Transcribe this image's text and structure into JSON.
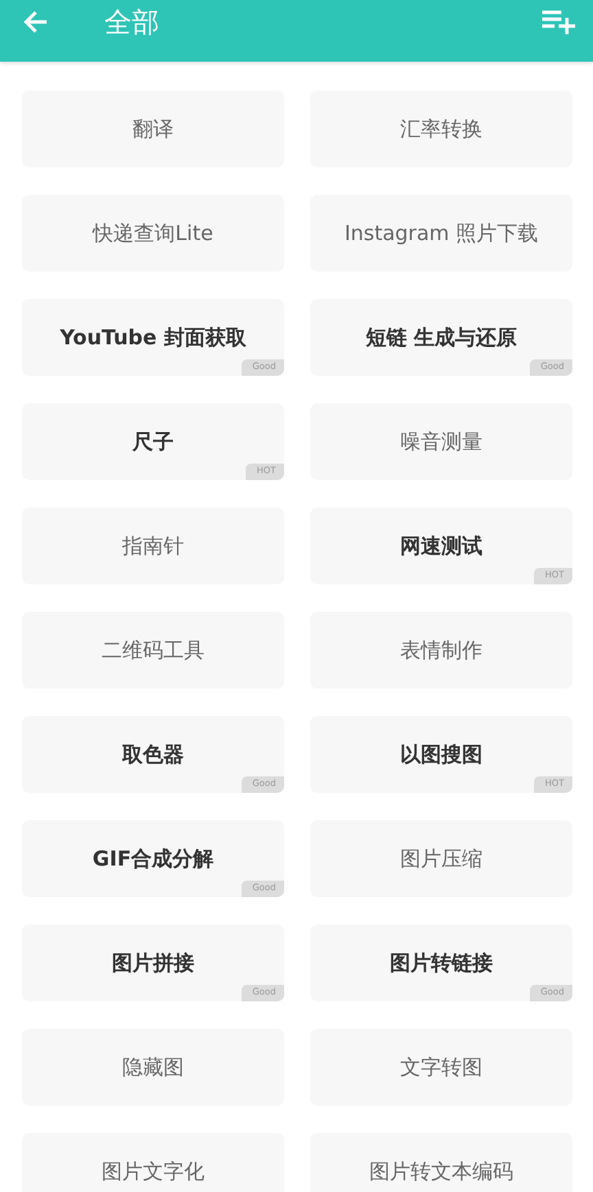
{
  "header": {
    "title": "全部"
  },
  "tools": [
    {
      "label": "翻译",
      "featured": false
    },
    {
      "label": "汇率转换",
      "featured": false
    },
    {
      "label": "快递查询Lite",
      "featured": false
    },
    {
      "label": "Instagram 照片下载",
      "featured": false
    },
    {
      "label": "YouTube 封面获取",
      "featured": true,
      "badge": "Good"
    },
    {
      "label": "短链 生成与还原",
      "featured": true,
      "badge": "Good"
    },
    {
      "label": "尺子",
      "featured": true,
      "badge": "HOT"
    },
    {
      "label": "噪音测量",
      "featured": false
    },
    {
      "label": "指南针",
      "featured": false
    },
    {
      "label": "网速测试",
      "featured": true,
      "badge": "HOT"
    },
    {
      "label": "二维码工具",
      "featured": false
    },
    {
      "label": "表情制作",
      "featured": false
    },
    {
      "label": "取色器",
      "featured": true,
      "badge": "Good"
    },
    {
      "label": "以图搜图",
      "featured": true,
      "badge": "HOT"
    },
    {
      "label": "GIF合成分解",
      "featured": true,
      "badge": "Good"
    },
    {
      "label": "图片压缩",
      "featured": false
    },
    {
      "label": "图片拼接",
      "featured": true,
      "badge": "Good"
    },
    {
      "label": "图片转链接",
      "featured": true,
      "badge": "Good"
    },
    {
      "label": "隐藏图",
      "featured": false
    },
    {
      "label": "文字转图",
      "featured": false
    },
    {
      "label": "图片文字化",
      "featured": false
    },
    {
      "label": "图片转文本编码",
      "featured": false
    }
  ]
}
